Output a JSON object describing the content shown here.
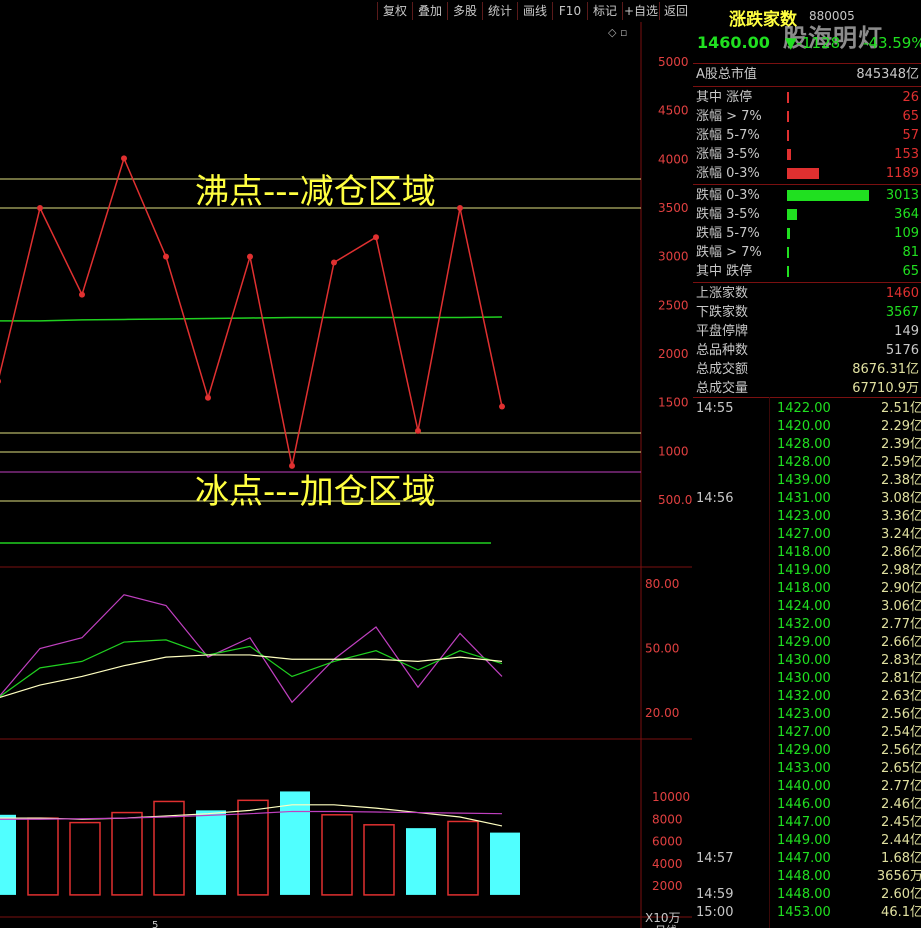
{
  "toolbar": {
    "buttons": [
      "复权",
      "叠加",
      "多股",
      "统计",
      "画线",
      "F10",
      "标记",
      "+自选",
      "返回"
    ]
  },
  "chart": {
    "zone_top_label": "沸点---减仓区域",
    "zone_bottom_label": "冰点---加仓区域",
    "main_axis_ticks": [
      "5000",
      "4500",
      "4000",
      "3500",
      "3000",
      "2500",
      "2000",
      "1500",
      "1000",
      "500.00"
    ],
    "osc_axis_ticks": [
      "80.00",
      "50.00",
      "20.00"
    ],
    "vol_axis_ticks": [
      "10000",
      "8000",
      "6000",
      "4000",
      "2000"
    ],
    "vol_unit": "X10万",
    "date_marker": "5",
    "period_label": "日线",
    "colors": {
      "price_line": "#e03030",
      "ma_line": "#20d020",
      "ref_line": "#e0e080",
      "purple_line": "#c040c0",
      "bar_up": "#e03030",
      "bar_down": "#50ffff",
      "grid": "#7a1010"
    }
  },
  "chart_data": {
    "type": "line",
    "main_series": [
      1720,
      3500,
      2610,
      4010,
      3000,
      1550,
      3000,
      850,
      2940,
      3200,
      1210,
      3500,
      1460
    ],
    "main_ma": [
      2340,
      2340,
      2350,
      2355,
      2360,
      2365,
      2370,
      2375,
      2375,
      2375,
      2375,
      2375,
      2380
    ],
    "osc_purple": [
      27,
      50,
      55,
      75,
      70,
      46,
      55,
      25,
      45,
      60,
      32,
      57,
      37
    ],
    "osc_green": [
      27,
      41,
      44,
      53,
      54,
      47,
      51,
      37,
      44,
      49,
      40,
      49,
      43
    ],
    "osc_yellow": [
      27,
      33,
      37,
      42,
      46,
      47,
      47,
      45,
      45,
      45,
      44,
      46,
      44
    ],
    "volume": [
      8400,
      8100,
      7700,
      8600,
      9600,
      8800,
      9700,
      10500,
      8400,
      7500,
      7200,
      7800,
      6800
    ],
    "volume_up": [
      false,
      true,
      true,
      true,
      true,
      false,
      true,
      false,
      true,
      true,
      false,
      true,
      false
    ],
    "vol_ma_yellow": [
      8100,
      8100,
      8000,
      8100,
      8300,
      8500,
      8800,
      9300,
      9300,
      9000,
      8600,
      8200,
      7400
    ],
    "vol_ma_purple": [
      8000,
      8000,
      8050,
      8100,
      8200,
      8350,
      8500,
      8700,
      8700,
      8650,
      8600,
      8550,
      8500
    ],
    "ylim_main": [
      0,
      5200
    ],
    "ylim_osc": [
      10,
      90
    ],
    "ylim_vol": [
      1000,
      12000
    ]
  },
  "panel": {
    "title": "涨跌家数",
    "code": "880005",
    "watermark": "股海明灯",
    "price": "1460.00",
    "change": "▼-1128",
    "change_pct": "-43.59%",
    "market_cap_label": "A股总市值",
    "market_cap_value": "845348亿",
    "up_rows": [
      {
        "label": "其中 涨停",
        "value": "26"
      },
      {
        "label": "涨幅 > 7%",
        "value": "65"
      },
      {
        "label": "涨幅 5-7%",
        "value": "57"
      },
      {
        "label": "涨幅 3-5%",
        "value": "153"
      },
      {
        "label": "涨幅 0-3%",
        "value": "1189"
      }
    ],
    "down_rows": [
      {
        "label": "跌幅 0-3%",
        "value": "3013"
      },
      {
        "label": "跌幅 3-5%",
        "value": "364"
      },
      {
        "label": "跌幅 5-7%",
        "value": "109"
      },
      {
        "label": "跌幅 > 7%",
        "value": "81"
      },
      {
        "label": "其中 跌停",
        "value": "65"
      }
    ],
    "stats": [
      {
        "label": "上涨家数",
        "value": "1460",
        "color": "#e03030"
      },
      {
        "label": "下跌家数",
        "value": "3567",
        "color": "#20e020"
      },
      {
        "label": "平盘停牌",
        "value": "149",
        "color": "#c8c8c8"
      },
      {
        "label": "总品种数",
        "value": "5176",
        "color": "#c8c8c8"
      },
      {
        "label": "总成交额",
        "value": "8676.31亿",
        "color": "#e0e0a0"
      },
      {
        "label": "总成交量",
        "value": "67710.9万",
        "color": "#e0e0a0"
      }
    ],
    "ticks": [
      {
        "time": "14:55",
        "price": "1422.00",
        "amount": "2.51亿"
      },
      {
        "time": "",
        "price": "1420.00",
        "amount": "2.29亿"
      },
      {
        "time": "",
        "price": "1428.00",
        "amount": "2.39亿"
      },
      {
        "time": "",
        "price": "1428.00",
        "amount": "2.59亿"
      },
      {
        "time": "",
        "price": "1439.00",
        "amount": "2.38亿"
      },
      {
        "time": "14:56",
        "price": "1431.00",
        "amount": "3.08亿"
      },
      {
        "time": "",
        "price": "1423.00",
        "amount": "3.36亿"
      },
      {
        "time": "",
        "price": "1427.00",
        "amount": "3.24亿"
      },
      {
        "time": "",
        "price": "1418.00",
        "amount": "2.86亿"
      },
      {
        "time": "",
        "price": "1419.00",
        "amount": "2.98亿"
      },
      {
        "time": "",
        "price": "1418.00",
        "amount": "2.90亿"
      },
      {
        "time": "",
        "price": "1424.00",
        "amount": "3.06亿"
      },
      {
        "time": "",
        "price": "1432.00",
        "amount": "2.77亿"
      },
      {
        "time": "",
        "price": "1429.00",
        "amount": "2.66亿"
      },
      {
        "time": "",
        "price": "1430.00",
        "amount": "2.83亿"
      },
      {
        "time": "",
        "price": "1430.00",
        "amount": "2.81亿"
      },
      {
        "time": "",
        "price": "1432.00",
        "amount": "2.63亿"
      },
      {
        "time": "",
        "price": "1423.00",
        "amount": "2.56亿"
      },
      {
        "time": "",
        "price": "1427.00",
        "amount": "2.54亿"
      },
      {
        "time": "",
        "price": "1429.00",
        "amount": "2.56亿"
      },
      {
        "time": "",
        "price": "1433.00",
        "amount": "2.65亿"
      },
      {
        "time": "",
        "price": "1440.00",
        "amount": "2.77亿"
      },
      {
        "time": "",
        "price": "1446.00",
        "amount": "2.46亿"
      },
      {
        "time": "",
        "price": "1447.00",
        "amount": "2.45亿"
      },
      {
        "time": "",
        "price": "1449.00",
        "amount": "2.44亿"
      },
      {
        "time": "14:57",
        "price": "1447.00",
        "amount": "1.68亿"
      },
      {
        "time": "",
        "price": "1448.00",
        "amount": "3656万"
      },
      {
        "time": "14:59",
        "price": "1448.00",
        "amount": "2.60亿"
      },
      {
        "time": "15:00",
        "price": "1453.00",
        "amount": "46.1亿"
      }
    ]
  }
}
